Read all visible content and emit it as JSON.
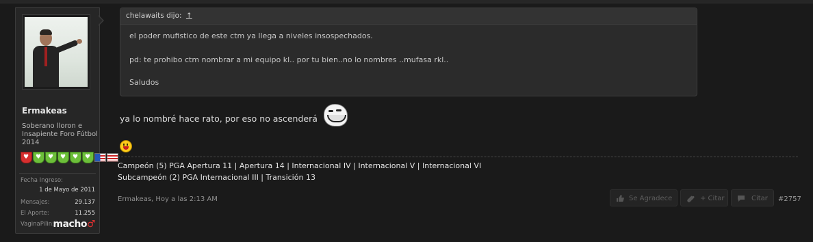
{
  "user": {
    "name": "Ermakeas",
    "title": "Soberano lloron e Insapiente Foro Fútbol 2014",
    "info": [
      {
        "label": "Fecha Ingreso:",
        "value": "1 de Mayo de 2011"
      },
      {
        "label": "Mensajes:",
        "value": "29.137"
      },
      {
        "label": "El Aporte:",
        "value": "11.255"
      },
      {
        "label": "VaginaPilin:",
        "value": "macho"
      }
    ],
    "badges": [
      "red-heart-badge",
      "green-heart-badge",
      "green-heart-badge",
      "green-heart-badge",
      "green-heart-badge",
      "green-heart-badge",
      "flag-badge",
      "flag-badge"
    ]
  },
  "quote": {
    "author": "chelawaits dijo:",
    "link": "↑",
    "lines": [
      "el poder mufistico de este ctm ya llega a niveles insospechados.",
      "pd: te prohibo ctm nombrar a mi equipo kl.. por tu bien..no lo nombres ..mufasa rkl..",
      "Saludos"
    ]
  },
  "post": {
    "text": "ya lo nombré hace rato, por eso no ascenderá",
    "emoticons": [
      "trollface-icon",
      "laughing-smiley-icon"
    ]
  },
  "signature": {
    "line1": "Campeón (5) PGA Apertura 11 | Apertura 14 | Internacional IV | Internacional V | Internacional VI",
    "line2": "Subcampeón (2) PGA Internacional III | Transición 13"
  },
  "footer": {
    "meta": "Ermakeas, Hoy a las 2:13 AM",
    "buttons": {
      "thanks": "Se Agradece",
      "multiquote": "+ Citar",
      "quote": "Citar"
    },
    "post_number": "#2757"
  },
  "colors": {
    "background": "#1a1a1a",
    "panel": "#262626",
    "quote_bg": "#2b2b2b"
  }
}
